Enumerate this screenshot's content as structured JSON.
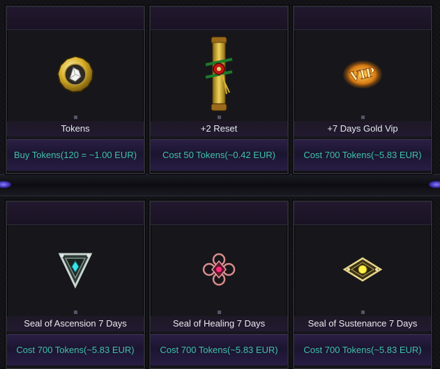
{
  "shop": {
    "items": [
      {
        "name": "Tokens",
        "price": "Buy Tokens(120 = ~1.00 EUR)",
        "icon": "token-coin-icon"
      },
      {
        "name": "+2 Reset",
        "price": "Cost 50 Tokens(~0.42 EUR)",
        "icon": "scroll-icon"
      },
      {
        "name": "+7 Days Gold Vip",
        "price": "Cost 700 Tokens(~5.83 EUR)",
        "icon": "vip-badge-icon"
      },
      {
        "name": "Seal of Ascension 7 Days",
        "price": "Cost 700 Tokens(~5.83 EUR)",
        "icon": "ascension-seal-icon"
      },
      {
        "name": "Seal of Healing 7 Days",
        "price": "Cost 700 Tokens(~5.83 EUR)",
        "icon": "healing-seal-icon"
      },
      {
        "name": "Seal of Sustenance 7 Days",
        "price": "Cost 700 Tokens(~5.83 EUR)",
        "icon": "sustenance-seal-icon"
      }
    ],
    "vip_text": "VIP"
  },
  "colors": {
    "price_text": "#41c1ad",
    "name_text": "#e9e9ef",
    "panel_bg": "#17171b",
    "accent_purple": "#2b1f45"
  }
}
